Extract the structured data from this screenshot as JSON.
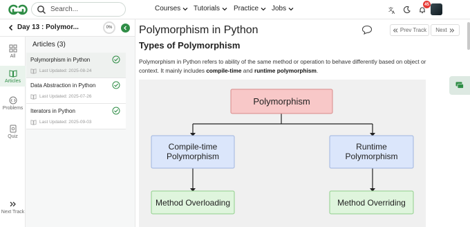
{
  "header": {
    "search_placeholder": "Search...",
    "nav": [
      "Courses",
      "Tutorials",
      "Practice",
      "Jobs"
    ],
    "notification_count": "45"
  },
  "sidebar": {
    "course_title": "Day 13 : Polymor...",
    "progress": "0%",
    "rail": [
      {
        "label": "All",
        "icon": "grid-icon"
      },
      {
        "label": "Articles",
        "icon": "book-icon"
      },
      {
        "label": "Problems",
        "icon": "code-icon"
      },
      {
        "label": "Quiz",
        "icon": "quiz-icon"
      }
    ],
    "next_track": "Next Track",
    "articles_heading": "Articles (3)",
    "articles": [
      {
        "title": "Polymorphism in Python",
        "date": "Last Updated: 2025-08-24"
      },
      {
        "title": "Data Abstraction in Python",
        "date": "Last Updated: 2025-07-26"
      },
      {
        "title": "Iterators in Python",
        "date": "Last Updated: 2025-09-03"
      }
    ]
  },
  "main": {
    "title": "Polymorphism in Python",
    "prev_label": "Prev Track",
    "next_label": "Next",
    "subheading": "Types of Polymorphism",
    "para_start": "Polymorphism in Python refers to ability of the same method or operation to behave differently based on object or context. It mainly includes ",
    "para_b1": "compile-time",
    "para_mid": " and ",
    "para_b2": "runtime polymorphism",
    "para_end": "."
  },
  "diagram": {
    "root": "Polymorphism",
    "left": [
      "Compile-time",
      "Polymorphism"
    ],
    "right": [
      "Runtime",
      "Polymorphism"
    ],
    "left_leaf": "Method Overloading",
    "right_leaf": "Method Overriding",
    "colors": {
      "root_fill": "#f8c8c8",
      "mid_fill": "#dbe6fb",
      "leaf_fill": "#dff5dd",
      "brand": "#2f8d46"
    }
  }
}
